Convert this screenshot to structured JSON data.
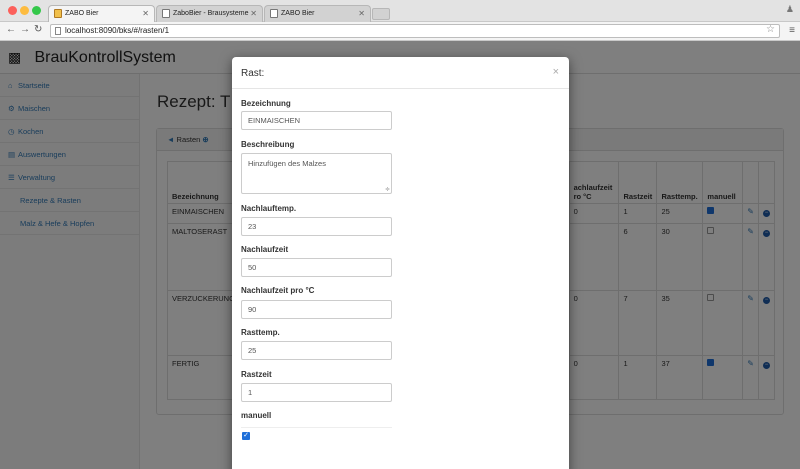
{
  "browser": {
    "tabs": [
      {
        "label": "ZABO Bier",
        "active": true,
        "icon": "beer-icon"
      },
      {
        "label": "ZaboBier - Brausysteme",
        "active": false,
        "icon": "page-icon"
      },
      {
        "label": "ZABO Bier",
        "active": false,
        "icon": "page-icon"
      }
    ],
    "url": "localhost:8090/bks/#/rasten/1"
  },
  "app": {
    "brand": "BrauKontrollSystem",
    "sidebar": [
      {
        "label": "Startseite",
        "icon": "home-icon"
      },
      {
        "label": "Maischen",
        "icon": "cogs-icon"
      },
      {
        "label": "Kochen",
        "icon": "clock-icon"
      },
      {
        "label": "Auswertungen",
        "icon": "chart-icon"
      },
      {
        "label": "Verwaltung",
        "icon": "list-icon"
      },
      {
        "label": "Rezepte & Rasten",
        "icon": ""
      },
      {
        "label": "Malz & Hefe & Hopfen",
        "icon": ""
      }
    ],
    "page_title": "Rezept: T",
    "panel_heading": "Rasten",
    "table": {
      "headers": [
        "Bezeichnung",
        "achlaufzeit\nro °C",
        "Rastzeit",
        "Rasttemp.",
        "manuell"
      ],
      "rows": [
        {
          "name": "EINMAISCHEN",
          "col2": "0",
          "rastzeit": "1",
          "rasttemp": "25",
          "manuell": true
        },
        {
          "name": "MALTOSERAST",
          "col2": "",
          "rastzeit": "6",
          "rasttemp": "30",
          "manuell": false
        },
        {
          "name": "VERZUCKERUNG",
          "col2": "0",
          "rastzeit": "7",
          "rasttemp": "35",
          "manuell": false
        },
        {
          "name": "FERTIG",
          "col2": "0",
          "rastzeit": "1",
          "rasttemp": "37",
          "manuell": true
        }
      ]
    }
  },
  "modal": {
    "title": "Rast:",
    "close": "×",
    "fields": {
      "bezeichnung": {
        "label": "Bezeichnung",
        "value": "EINMAISCHEN"
      },
      "beschreibung": {
        "label": "Beschreibung",
        "value": "Hinzufügen des Malzes"
      },
      "nachlauftemp": {
        "label": "Nachlauftemp.",
        "value": "23"
      },
      "nachlaufzeit": {
        "label": "Nachlaufzeit",
        "value": "50"
      },
      "nachlaufzeit_pro_c": {
        "label": "Nachlaufzeit pro °C",
        "value": "90"
      },
      "rasttemp": {
        "label": "Rasttemp.",
        "value": "25"
      },
      "rastzeit": {
        "label": "Rastzeit",
        "value": "1"
      },
      "manuell": {
        "label": "manuell",
        "checked": true
      }
    }
  }
}
